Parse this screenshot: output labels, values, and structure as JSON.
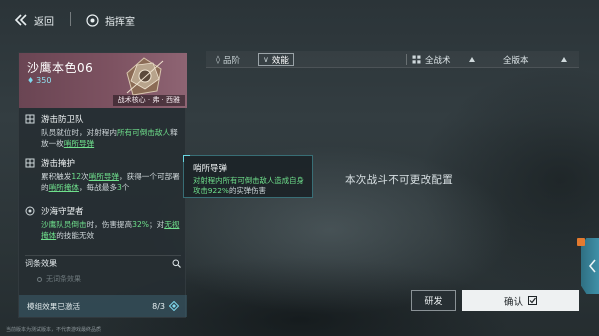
{
  "topbar": {
    "back_label": "返回",
    "hq_label": "指挥室"
  },
  "module": {
    "name": "沙鹰本色06",
    "cost": "350",
    "tag": "战术核心 · 弗 · 西雅",
    "card_color": "#7d5261"
  },
  "skills": [
    {
      "title": "游击防卫队",
      "icon": "shield-grid-icon",
      "parts": [
        "队员就位时，对射程内",
        "所有可倒击敌人",
        "释放一枚",
        "哨所导弹"
      ]
    },
    {
      "title": "游击掩护",
      "icon": "shield-grid-icon",
      "parts": [
        "累积触发",
        "12",
        "次",
        "哨所导弹",
        "，获得一个可部署的",
        "哨所掩体",
        "，每战最多",
        "3",
        "个"
      ]
    },
    {
      "title": "沙海守望者",
      "icon": "target-icon",
      "parts": [
        "沙鹰队员倒击",
        "时，伤害提高",
        "32%",
        "；对",
        "无视掩体",
        "的技能无效"
      ]
    }
  ],
  "affix": {
    "title": "词条效果",
    "empty": "无词条效果"
  },
  "status": {
    "label": "模组效果已激活",
    "count": "8/3"
  },
  "footnote": "当前版本为测试版本，不代表游戏最终品质",
  "filters": {
    "tab_quality": "品阶",
    "tab_effect": "效能",
    "dropdown_tactics": "全战术",
    "dropdown_version": "全版本"
  },
  "notice": "本次战斗不可更改配置",
  "tooltip": {
    "title": "哨所导弹",
    "body_prefix": "对射程内所有可倒击敌人造成自身攻击",
    "percent": "922%",
    "body_suffix": "的实弹伤害"
  },
  "buttons": {
    "develop": "研发",
    "confirm": "确认"
  },
  "colors": {
    "accent_green": "#6fe08c",
    "accent_cyan": "#69d7e2",
    "badge_orange": "#e37a2f"
  }
}
